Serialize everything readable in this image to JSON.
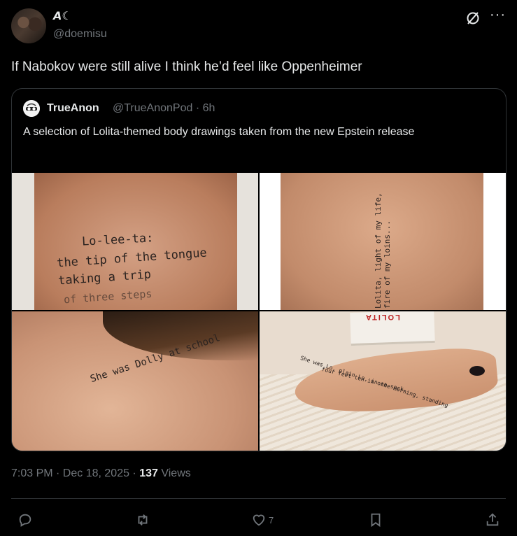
{
  "tweet": {
    "display_name": "𝘼☾",
    "handle": "@doemisu",
    "text": "If Nabokov were still alive I think he’d feel like Oppenheimer",
    "timestamp": "7:03 PM · Dec 18, 2025 · ",
    "views_count": "137",
    "views_label": " Views"
  },
  "quote": {
    "display_name": "TrueAnon",
    "handle": "@TrueAnonPod · 6h",
    "text": "A selection of Lolita-themed body drawings taken from the new Epstein release"
  },
  "images": {
    "img1_lines": [
      "Lo-lee-ta:",
      "the tip of the tongue",
      "taking a trip",
      "of three steps"
    ],
    "img2_text": "Lolita, light of my life, fire of my loins...",
    "img3_text": "She was Dolly at school",
    "img4_book": "LOLITA",
    "img4_lines": [
      "She was Lo, plain Lo, in the morning, standing",
      "four feet ten in one sock."
    ]
  },
  "actions": {
    "reply_count": "",
    "retweet_count": "",
    "like_count": "7",
    "bookmark_count": ""
  },
  "icons": [
    "grok-icon",
    "more-icon",
    "reply-icon",
    "retweet-icon",
    "like-icon",
    "bookmark-icon",
    "share-icon"
  ]
}
